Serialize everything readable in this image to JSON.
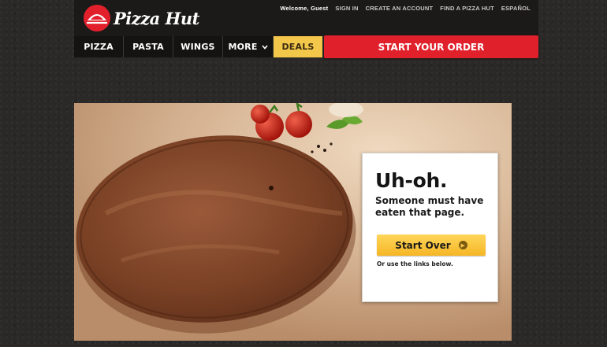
{
  "brand": {
    "name": "Pizza Hut"
  },
  "utility_nav": {
    "welcome": "Welcome, Guest",
    "links": [
      "SIGN IN",
      "CREATE AN ACCOUNT",
      "FIND A PIZZA HUT",
      "ESPAÑOL"
    ]
  },
  "main_nav": {
    "items": [
      "PIZZA",
      "PASTA",
      "WINGS",
      "MORE",
      "DEALS"
    ],
    "cta": "START YOUR ORDER"
  },
  "error_card": {
    "heading": "Uh-oh.",
    "message": "Someone must have eaten that page.",
    "button": "Start Over",
    "note": "Or use the links below."
  },
  "colors": {
    "brand_red": "#e0202b",
    "deals_yellow": "#f3c84a",
    "button_yellow": "#f5b625",
    "header_dark": "#1b1a19"
  }
}
